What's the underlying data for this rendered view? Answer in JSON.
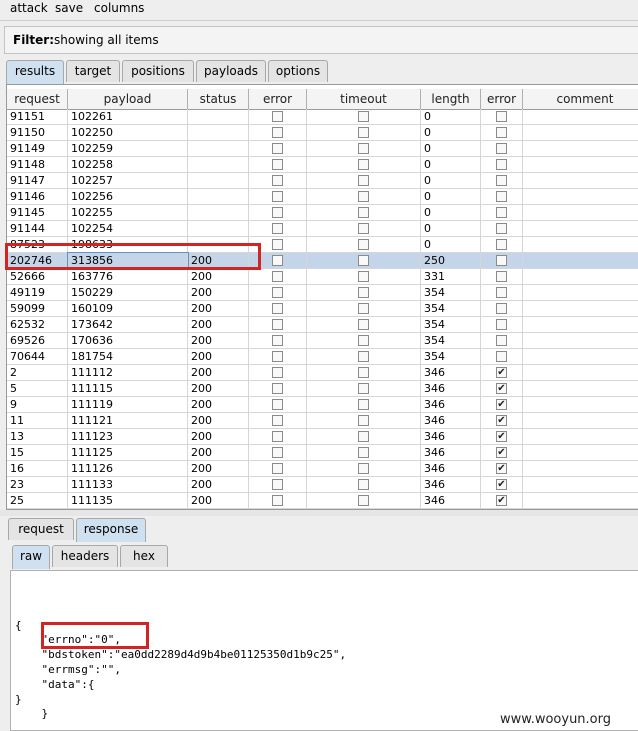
{
  "menu": [
    "attack",
    "save",
    "columns"
  ],
  "filter": {
    "label": "Filter:",
    "value": "showing all items"
  },
  "tabs": [
    "results",
    "target",
    "positions",
    "payloads",
    "options"
  ],
  "active_tab": "results",
  "table": {
    "columns": [
      "request",
      "payload",
      "status",
      "error",
      "timeout",
      "length",
      "error",
      "comment"
    ],
    "rows": [
      {
        "request": "91151",
        "payload": "102261",
        "status": "",
        "length": "0",
        "err2": false,
        "partial": true
      },
      {
        "request": "91150",
        "payload": "102250",
        "status": "",
        "length": "0",
        "err2": false
      },
      {
        "request": "91149",
        "payload": "102259",
        "status": "",
        "length": "0",
        "err2": false
      },
      {
        "request": "91148",
        "payload": "102258",
        "status": "",
        "length": "0",
        "err2": false
      },
      {
        "request": "91147",
        "payload": "102257",
        "status": "",
        "length": "0",
        "err2": false
      },
      {
        "request": "91146",
        "payload": "102256",
        "status": "",
        "length": "0",
        "err2": false
      },
      {
        "request": "91145",
        "payload": "102255",
        "status": "",
        "length": "0",
        "err2": false
      },
      {
        "request": "91144",
        "payload": "102254",
        "status": "",
        "length": "0",
        "err2": false
      },
      {
        "request": "87523",
        "payload": "198633",
        "status": "",
        "length": "0",
        "err2": false
      },
      {
        "request": "202746",
        "payload": "313856",
        "status": "200",
        "length": "250",
        "err2": false,
        "selected": true
      },
      {
        "request": "52666",
        "payload": "163776",
        "status": "200",
        "length": "331",
        "err2": false
      },
      {
        "request": "49119",
        "payload": "150229",
        "status": "200",
        "length": "354",
        "err2": false
      },
      {
        "request": "59099",
        "payload": "160109",
        "status": "200",
        "length": "354",
        "err2": false
      },
      {
        "request": "62532",
        "payload": "173642",
        "status": "200",
        "length": "354",
        "err2": false
      },
      {
        "request": "69526",
        "payload": "170636",
        "status": "200",
        "length": "354",
        "err2": false
      },
      {
        "request": "70644",
        "payload": "181754",
        "status": "200",
        "length": "354",
        "err2": false
      },
      {
        "request": "2",
        "payload": "111112",
        "status": "200",
        "length": "346",
        "err2": true
      },
      {
        "request": "5",
        "payload": "111115",
        "status": "200",
        "length": "346",
        "err2": true
      },
      {
        "request": "9",
        "payload": "111119",
        "status": "200",
        "length": "346",
        "err2": true
      },
      {
        "request": "11",
        "payload": "111121",
        "status": "200",
        "length": "346",
        "err2": true
      },
      {
        "request": "13",
        "payload": "111123",
        "status": "200",
        "length": "346",
        "err2": true
      },
      {
        "request": "15",
        "payload": "111125",
        "status": "200",
        "length": "346",
        "err2": true
      },
      {
        "request": "16",
        "payload": "111126",
        "status": "200",
        "length": "346",
        "err2": true
      },
      {
        "request": "23",
        "payload": "111133",
        "status": "200",
        "length": "346",
        "err2": true
      },
      {
        "request": "25",
        "payload": "111135",
        "status": "200",
        "length": "346",
        "err2": true
      }
    ]
  },
  "detail_tabs": [
    "request",
    "response"
  ],
  "active_detail_tab": "response",
  "view_tabs": [
    "raw",
    "headers",
    "hex"
  ],
  "active_view_tab": "raw",
  "response_lines": [
    "{",
    "    \"errno\":\"0\",",
    "    \"bdstoken\":\"ea0dd2289d4d9b4be01125350d1b9c25\",",
    "    \"errmsg\":\"\",",
    "    \"data\":{",
    "}",
    "    }"
  ],
  "watermark": "www.wooyun.org",
  "colors": {
    "selection": "#c5d5e9",
    "highlight_box": "#d32424",
    "active_tab": "#cfe0f0"
  }
}
